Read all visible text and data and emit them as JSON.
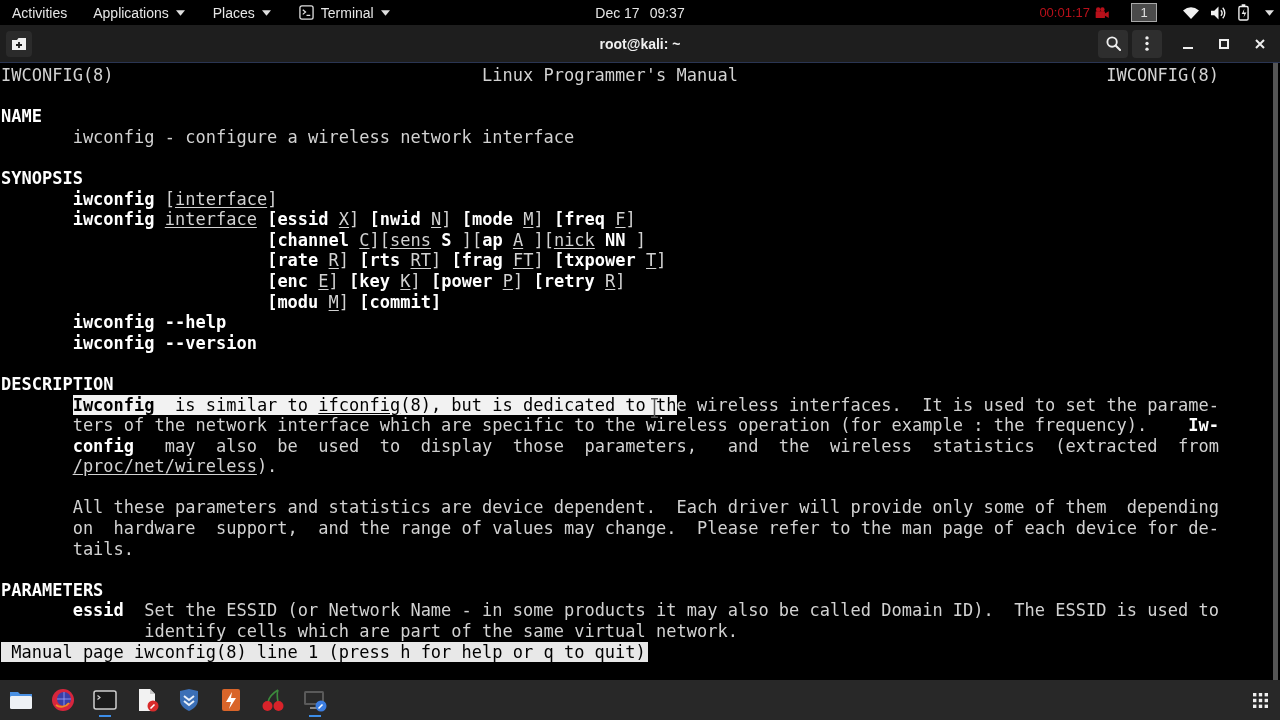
{
  "top_bar": {
    "activities": "Activities",
    "menus": [
      {
        "label": "Applications",
        "kind": "menu"
      },
      {
        "label": "Places",
        "kind": "menu"
      },
      {
        "label": "Terminal",
        "kind": "app"
      }
    ],
    "date": "Dec 17",
    "time": "09:37",
    "recording": "00:01:17",
    "workspace": "1"
  },
  "window": {
    "title": "root@kali: ~"
  },
  "manpage": {
    "header": {
      "left": "IWCONFIG(8)",
      "center": "Linux Programmer's Manual",
      "right": "IWCONFIG(8)"
    },
    "sections": [
      {
        "heading": "NAME",
        "kind": "text",
        "paragraphs": [
          {
            "lines": [
              {
                "kind": "plain",
                "text": "iwconfig - configure a wireless network interface"
              }
            ]
          }
        ]
      },
      {
        "heading": "SYNOPSIS",
        "kind": "synopsis",
        "forms": [
          {
            "kind": "plain",
            "command": "**iwconfig** [*interface*]"
          },
          {
            "kind": "plain",
            "command": "**iwconfig** *interface*",
            "options": [
              "**[essid** *X*] **[nwid** *N*] **[mode** *M*] **[freq** *F*]",
              "**[channel** *C*][*sens* **S** ][**ap** *A* ][*nick* **NN** ]",
              "**[rate** *R*] **[rts** *RT*] **[frag** *FT*] **[txpower** *T*]",
              "**[enc** *E*] **[key** *K*] **[power** *P*] **[retry** *R*]",
              "**[modu** *M*] **[commit]**"
            ]
          },
          {
            "kind": "bold",
            "command": "iwconfig --help"
          },
          {
            "kind": "bold",
            "command": "iwconfig --version"
          }
        ]
      },
      {
        "heading": "DESCRIPTION",
        "kind": "text",
        "paragraphs": [
          {
            "lines": [
              {
                "kind": "plain",
                "runs": [
                  {
                    "text": "**Iwconfig**  is similar to *ifconfig*(8), but is dedicated to th",
                    "selected": true
                  },
                  {
                    "text": "e wireless interfaces.  It is used to set the parame-",
                    "selected": false
                  }
                ]
              },
              {
                "kind": "plain",
                "text": "ters of the network interface which are specific to the wireless operation (for example : the frequency).    **Iw-**"
              },
              {
                "kind": "plain",
                "text": "**config**   may  also  be  used  to  display  those  parameters,   and  the  wireless  statistics  (extracted  from"
              },
              {
                "kind": "plain",
                "text": "*/proc/net/wireless*)."
              }
            ]
          },
          {
            "lines": [
              {
                "kind": "plain",
                "text": "All these parameters and statistics are device dependent.  Each driver will provide only some of them  depending"
              },
              {
                "kind": "plain",
                "text": "on  hardware  support,  and the range of values may change.  Please refer to the man page of each device for de-"
              },
              {
                "kind": "plain",
                "text": "tails."
              }
            ]
          }
        ]
      },
      {
        "heading": "PARAMETERS",
        "kind": "tagged",
        "items": [
          {
            "term": "essid",
            "lines": [
              {
                "kind": "plain",
                "text": "Set the ESSID (or Network Name - in some products it may also be called Domain ID).  The ESSID is used to"
              },
              {
                "kind": "plain",
                "text": "identify cells which are part of the same virtual network."
              }
            ]
          }
        ]
      }
    ]
  },
  "status_line": "Manual page iwconfig(8) line 1 (press h for help or q to quit)",
  "dock": {
    "apps": [
      {
        "kind": "files",
        "running": false
      },
      {
        "kind": "browser",
        "running": false
      },
      {
        "kind": "terminal",
        "running": true
      },
      {
        "kind": "editor",
        "running": false
      },
      {
        "kind": "framework",
        "running": false
      },
      {
        "kind": "proxy",
        "running": false
      },
      {
        "kind": "notes",
        "running": false
      },
      {
        "kind": "screenshot",
        "running": true
      }
    ]
  }
}
